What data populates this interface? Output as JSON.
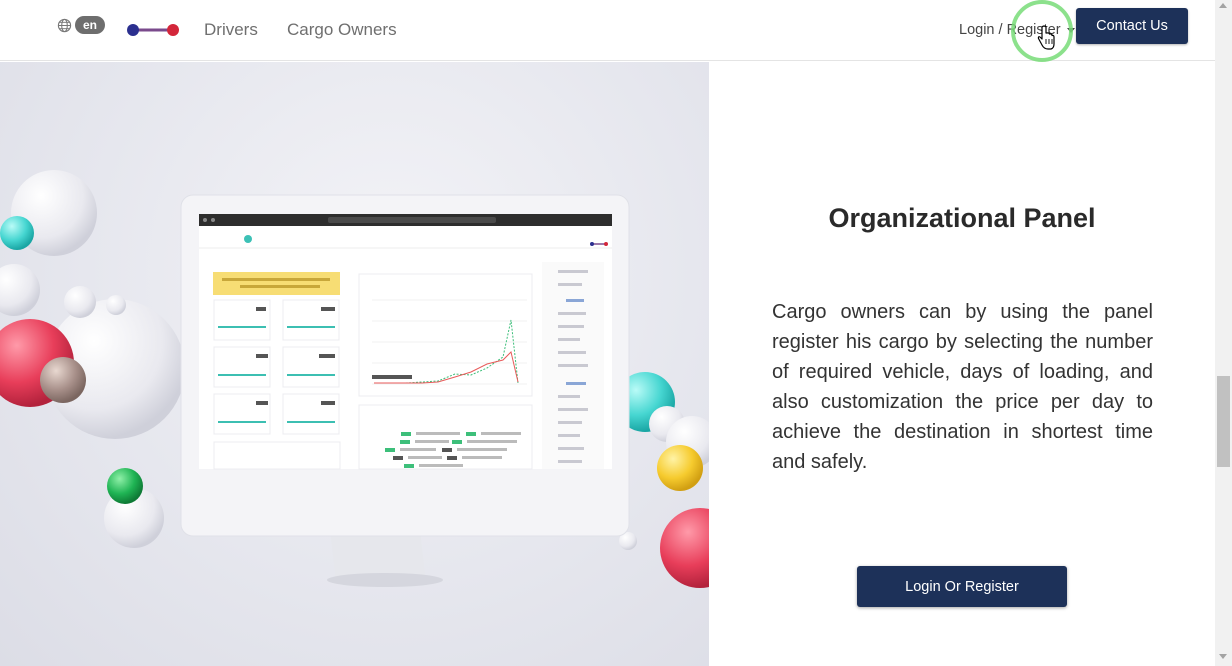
{
  "header": {
    "language": "en",
    "nav": [
      "Drivers",
      "Cargo Owners"
    ],
    "login": "Login / Register",
    "contact": "Contact Us"
  },
  "section": {
    "title": "Organizational Panel",
    "description": "Cargo owners can by using the panel register his cargo by selecting the number of required vehicle, days of loading, and also customization the price per day to achieve the destination in shortest time and safely.",
    "cta": "Login Or Register"
  },
  "colors": {
    "primary": "#1d3159",
    "logo_blue": "#2b2f8f",
    "logo_red": "#d3263a",
    "cursor_ring": "#7ddc7d"
  },
  "icons": [
    "globe-icon",
    "caret-down-icon",
    "hand-cursor-icon"
  ]
}
